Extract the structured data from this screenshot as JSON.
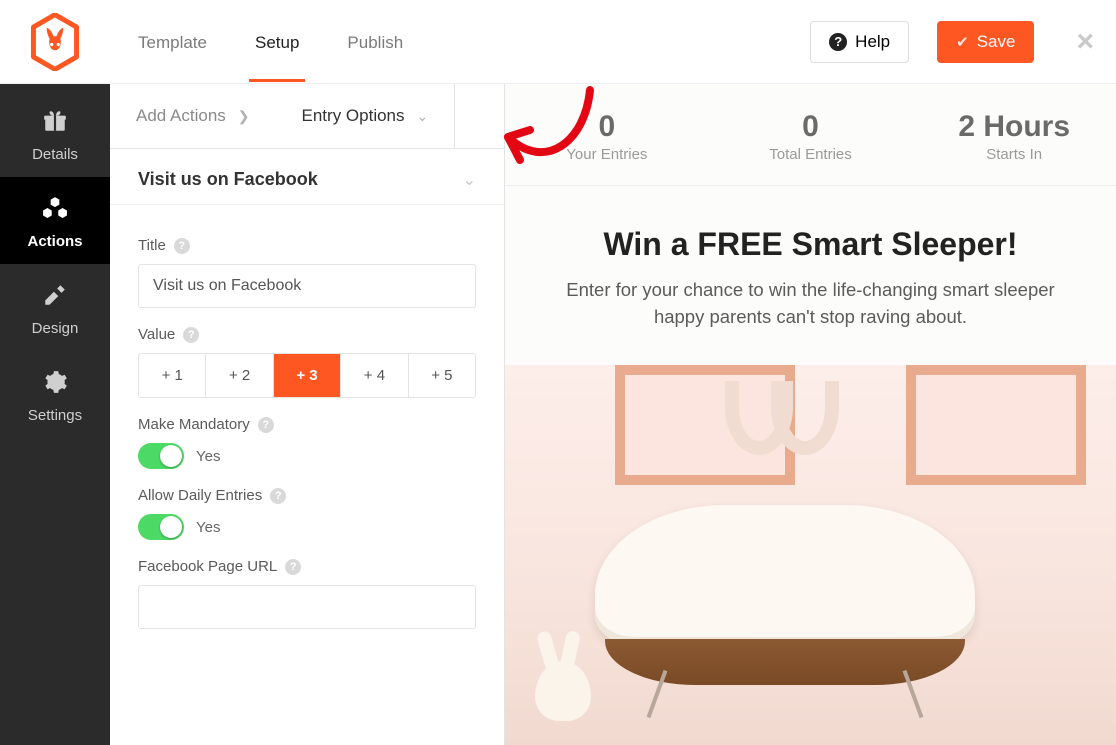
{
  "brand": {
    "accent": "#ff5722"
  },
  "top": {
    "tabs": [
      "Template",
      "Setup",
      "Publish"
    ],
    "active_tab": 1,
    "help": "Help",
    "save": "Save"
  },
  "sidebar": {
    "items": [
      {
        "label": "Details",
        "icon": "gift-icon"
      },
      {
        "label": "Actions",
        "icon": "blocks-icon"
      },
      {
        "label": "Design",
        "icon": "pencil-ruler-icon"
      },
      {
        "label": "Settings",
        "icon": "gear-icon"
      }
    ],
    "active": 1
  },
  "panel": {
    "subtabs": [
      {
        "label": "Add Actions",
        "chev": "right"
      },
      {
        "label": "Entry Options",
        "chev": "down"
      }
    ],
    "section_title": "Visit us on Facebook",
    "fields": {
      "title_label": "Title",
      "title_value": "Visit us on Facebook",
      "value_label": "Value",
      "value_options": [
        "+ 1",
        "+ 2",
        "+ 3",
        "+ 4",
        "+ 5"
      ],
      "value_selected": 2,
      "mandatory_label": "Make Mandatory",
      "mandatory_on": "Yes",
      "daily_label": "Allow Daily Entries",
      "daily_on": "Yes",
      "fburl_label": "Facebook Page URL",
      "fburl_value": ""
    }
  },
  "preview": {
    "stats": [
      {
        "n": "0",
        "l": "Your Entries"
      },
      {
        "n": "0",
        "l": "Total Entries"
      },
      {
        "n": "2 Hours",
        "l": "Starts In"
      }
    ],
    "headline": "Win a FREE Smart Sleeper!",
    "subhead": "Enter for your chance to win the life-changing smart sleeper happy parents can't stop raving about."
  }
}
